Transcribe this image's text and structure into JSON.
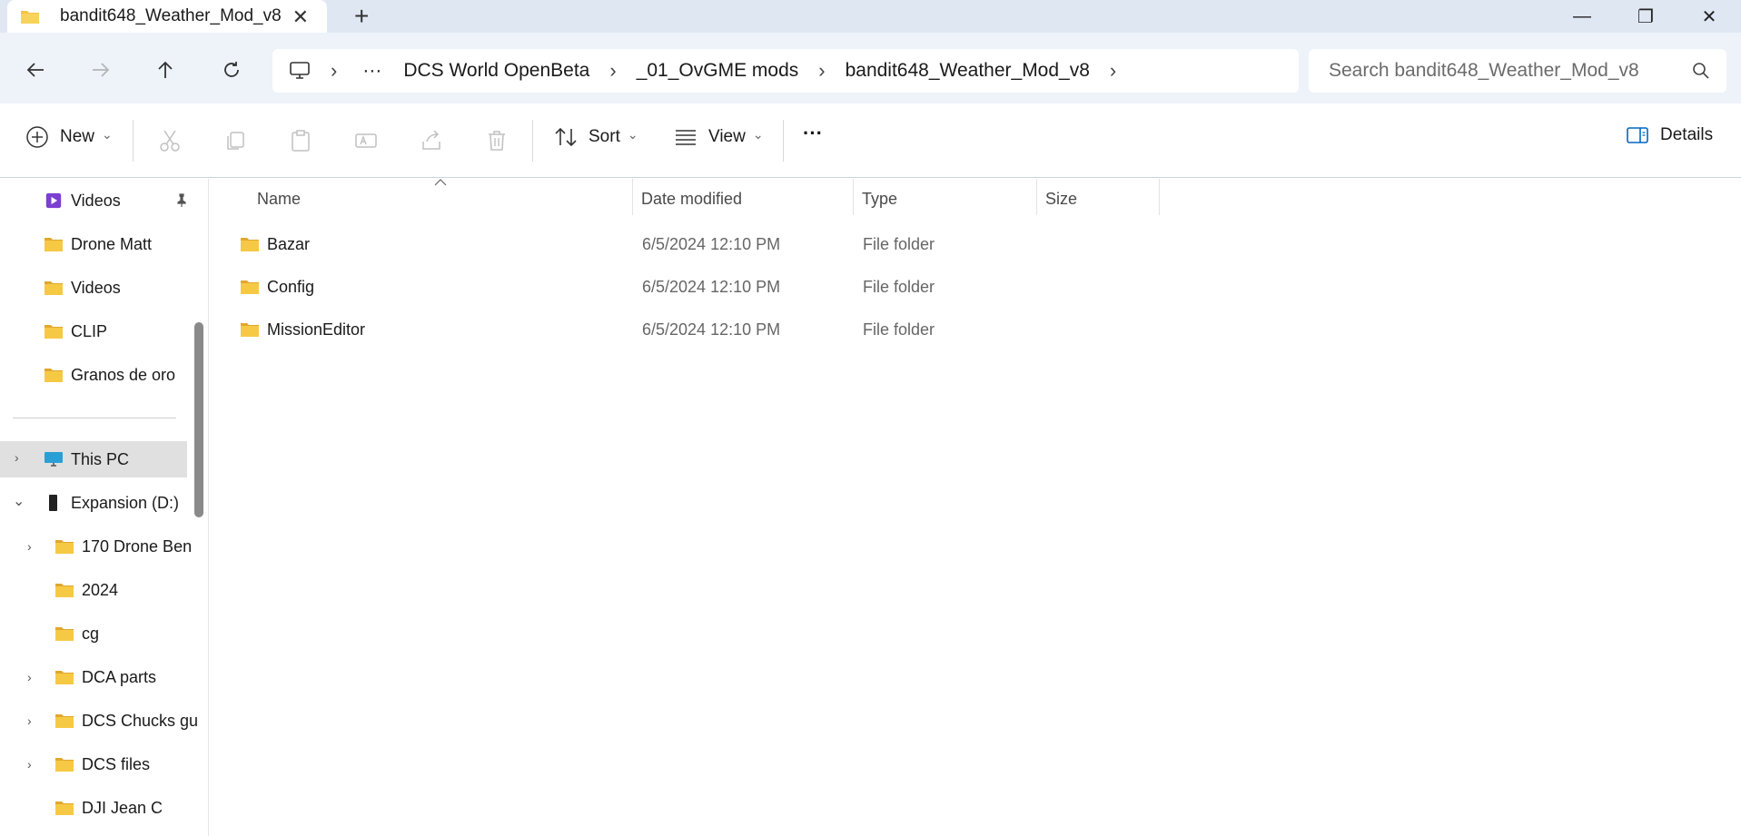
{
  "window": {
    "tab_title": "bandit648_Weather_Mod_v8",
    "close_tab_glyph": "✕",
    "new_tab_glyph": "+",
    "minimize_glyph": "—",
    "maximize_glyph": "❐",
    "close_glyph": "✕"
  },
  "address": {
    "overflow": "···",
    "breadcrumbs": [
      "DCS World OpenBeta",
      "_01_OvGME mods",
      "bandit648_Weather_Mod_v8"
    ],
    "sep": "›"
  },
  "search": {
    "placeholder": "Search bandit648_Weather_Mod_v8"
  },
  "toolbar": {
    "new_label": "New",
    "sort_label": "Sort",
    "view_label": "View",
    "more_glyph": "···",
    "details_label": "Details",
    "caret": "⌄"
  },
  "sidebar": {
    "pinned": [
      {
        "label": "Videos",
        "icon": "videos-icon"
      },
      {
        "label": "Drone Matt",
        "icon": "folder-icon"
      },
      {
        "label": "Videos",
        "icon": "folder-icon"
      },
      {
        "label": "CLIP",
        "icon": "folder-icon"
      },
      {
        "label": "Granos de oro",
        "icon": "folder-icon"
      }
    ],
    "this_pc": "This PC",
    "drive": "Expansion (D:)",
    "drive_children": [
      {
        "label": "170 Drone Ben",
        "expandable": true
      },
      {
        "label": "2024",
        "expandable": false
      },
      {
        "label": "cg",
        "expandable": false
      },
      {
        "label": "DCA parts",
        "expandable": true
      },
      {
        "label": "DCS Chucks gu",
        "expandable": true
      },
      {
        "label": "DCS files",
        "expandable": true
      },
      {
        "label": "DJI Jean C",
        "expandable": false
      }
    ]
  },
  "columns": {
    "name": "Name",
    "date": "Date modified",
    "type": "Type",
    "size": "Size"
  },
  "files": [
    {
      "name": "Bazar",
      "date": "6/5/2024 12:10 PM",
      "type": "File folder",
      "size": ""
    },
    {
      "name": "Config",
      "date": "6/5/2024 12:10 PM",
      "type": "File folder",
      "size": ""
    },
    {
      "name": "MissionEditor",
      "date": "6/5/2024 12:10 PM",
      "type": "File folder",
      "size": ""
    }
  ],
  "colors": {
    "folder": "#f4c542",
    "folder_dark": "#e0a82e",
    "accent": "#0067c0",
    "selected": "#e0e0e0"
  }
}
